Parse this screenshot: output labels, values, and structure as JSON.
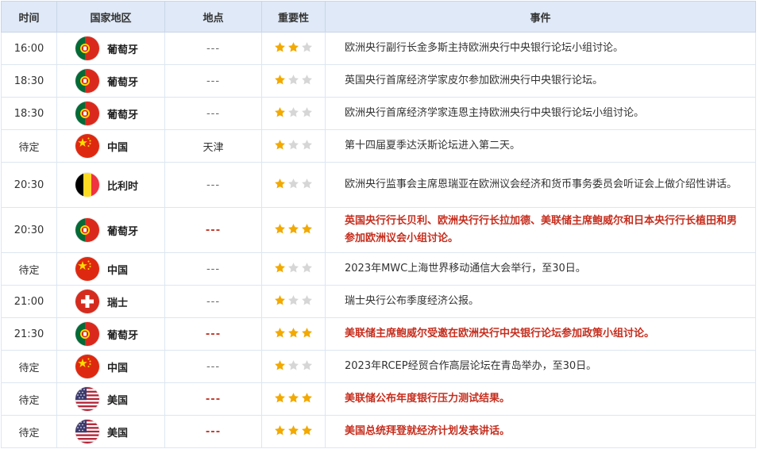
{
  "headers": {
    "time": "时间",
    "country": "国家地区",
    "location": "地点",
    "importance": "重要性",
    "event": "事件"
  },
  "colors": {
    "header_bg": "#dfe9f7",
    "star_on": "#f2a900",
    "star_off": "#d6d6d6",
    "highlight_text": "#c62e1e"
  },
  "rows": [
    {
      "time": "16:00",
      "country": "葡萄牙",
      "flag": "portugal-flag",
      "location": "---",
      "stars": 2,
      "event": "欧洲央行副行长金多斯主持欧洲央行中央银行论坛小组讨论。",
      "highlight": false
    },
    {
      "time": "18:30",
      "country": "葡萄牙",
      "flag": "portugal-flag",
      "location": "---",
      "stars": 1,
      "event": "英国央行首席经济学家皮尔参加欧洲央行中央银行论坛。",
      "highlight": false
    },
    {
      "time": "18:30",
      "country": "葡萄牙",
      "flag": "portugal-flag",
      "location": "---",
      "stars": 1,
      "event": "欧洲央行首席经济学家连恩主持欧洲央行中央银行论坛小组讨论。",
      "highlight": false
    },
    {
      "time": "待定",
      "country": "中国",
      "flag": "china-flag",
      "location": "天津",
      "stars": 1,
      "event": "第十四届夏季达沃斯论坛进入第二天。",
      "highlight": false
    },
    {
      "time": "20:30",
      "country": "比利时",
      "flag": "belgium-flag",
      "location": "---",
      "stars": 1,
      "event": "欧洲央行监事会主席恩瑞亚在欧洲议会经济和货币事务委员会听证会上做介绍性讲话。",
      "highlight": false,
      "tall": true
    },
    {
      "time": "20:30",
      "country": "葡萄牙",
      "flag": "portugal-flag",
      "location": "---",
      "stars": 3,
      "event": "英国央行行长贝利、欧洲央行行长拉加德、美联储主席鲍威尔和日本央行行长植田和男参加欧洲议会小组讨论。",
      "highlight": true,
      "tall": true
    },
    {
      "time": "待定",
      "country": "中国",
      "flag": "china-flag",
      "location": "---",
      "stars": 1,
      "event": "2023年MWC上海世界移动通信大会举行，至30日。",
      "highlight": false
    },
    {
      "time": "21:00",
      "country": "瑞士",
      "flag": "switzerland-flag",
      "location": "---",
      "stars": 1,
      "event": "瑞士央行公布季度经济公报。",
      "highlight": false
    },
    {
      "time": "21:30",
      "country": "葡萄牙",
      "flag": "portugal-flag",
      "location": "---",
      "stars": 3,
      "event": "美联储主席鲍威尔受邀在欧洲央行中央银行论坛参加政策小组讨论。",
      "highlight": true
    },
    {
      "time": "待定",
      "country": "中国",
      "flag": "china-flag",
      "location": "---",
      "stars": 1,
      "event": "2023年RCEP经贸合作高层论坛在青岛举办，至30日。",
      "highlight": false
    },
    {
      "time": "待定",
      "country": "美国",
      "flag": "usa-flag",
      "location": "---",
      "stars": 3,
      "event": "美联储公布年度银行压力测试结果。",
      "highlight": true
    },
    {
      "time": "待定",
      "country": "美国",
      "flag": "usa-flag",
      "location": "---",
      "stars": 3,
      "event": "美国总统拜登就经济计划发表讲话。",
      "highlight": true
    }
  ]
}
